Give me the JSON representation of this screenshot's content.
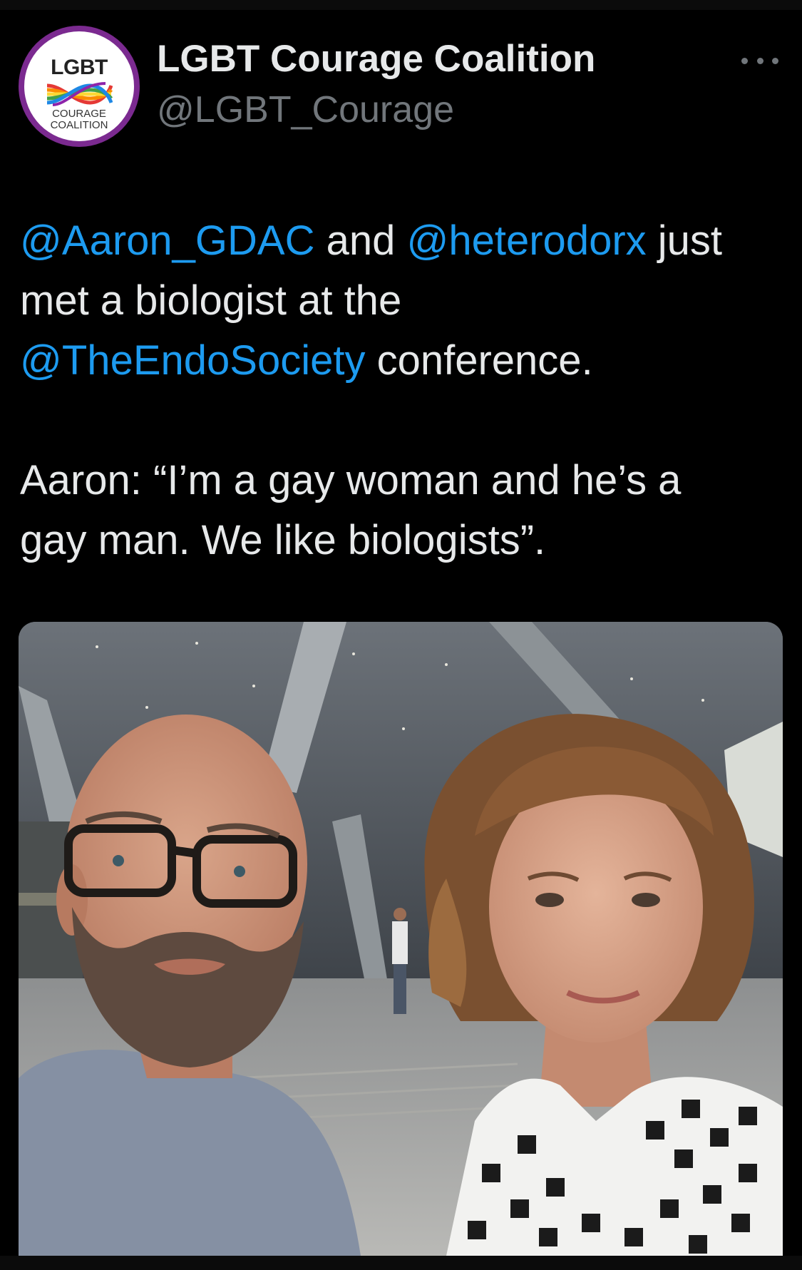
{
  "account": {
    "display_name": "LGBT Courage Coalition",
    "handle": "@LGBT_Courage",
    "avatar": {
      "line1": "LGBT",
      "line2": "COURAGE",
      "line3": "COALITION",
      "ring_color": "#7b2a90"
    }
  },
  "tweet": {
    "segments": {
      "m1": "@Aaron_GDAC",
      "t1": " and ",
      "m2": "@heterodorx",
      "t2": " just",
      "l2": "met a biologist at the",
      "m3": "@TheEndoSociety",
      "t3": " conference.",
      "l4": "Aaron: “I’m a gay woman and he’s a",
      "l5": "gay man. We like biologists”."
    },
    "mention_color": "#1d9bf0"
  },
  "media": {
    "description_icon": "photo-icon"
  },
  "colors": {
    "background": "#000000",
    "text": "#e7e9ea",
    "secondary": "#71767b"
  }
}
